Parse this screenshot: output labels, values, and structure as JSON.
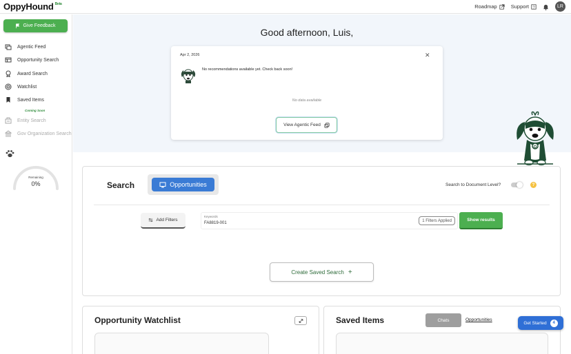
{
  "app": {
    "name": "OppyHound",
    "badge": "Beta"
  },
  "topnav": {
    "roadmap": "Roadmap",
    "support": "Support",
    "avatar_initials": "LR"
  },
  "sidebar": {
    "feedback_label": "Give Feedback",
    "items": [
      {
        "label": "Agentic Feed",
        "icon": "feed-icon",
        "enabled": true
      },
      {
        "label": "Opportunity Search",
        "icon": "table-icon",
        "enabled": true
      },
      {
        "label": "Award Search",
        "icon": "award-icon",
        "enabled": true
      },
      {
        "label": "Watchlist",
        "icon": "watchlist-icon",
        "enabled": true
      },
      {
        "label": "Saved Items",
        "icon": "bookmark-icon",
        "enabled": true
      },
      {
        "label": "Entity Search",
        "icon": "entity-icon",
        "enabled": false
      },
      {
        "label": "Gov Organization Search",
        "icon": "building-icon",
        "enabled": false
      }
    ],
    "coming_soon": "Coming Soon",
    "gauge": {
      "label": "Remaining",
      "value": "0%",
      "fraction": 0
    }
  },
  "hero": {
    "greeting": "Good afternoon, Luis,",
    "card": {
      "date": "Apr 2, 2026",
      "message": "No recommendations available yet. Check back soon!",
      "empty_text": "No data available",
      "view_button": "View Agentic Feed"
    }
  },
  "search": {
    "title": "Search",
    "mode": "Opportunities",
    "doc_level_label": "Search to Document Level?",
    "doc_level_on": false,
    "add_filters": "Add Filters",
    "keywords_label": "Keywords",
    "keywords_value": "FA8819-001",
    "filters_applied": "1 Filters Applied",
    "show_results": "Show results",
    "create_saved": "Create Saved Search"
  },
  "watchlist": {
    "title": "Opportunity Watchlist"
  },
  "saved_items": {
    "title": "Saved Items",
    "tabs": [
      "Chats",
      "Opportunities"
    ],
    "active_tab": "Chats"
  },
  "get_started": {
    "label": "Get Started",
    "count": "4"
  },
  "colors": {
    "brand_green": "#4caf50",
    "accent_blue": "#3a7bd5",
    "hero_bg": "#f2f6fb"
  }
}
